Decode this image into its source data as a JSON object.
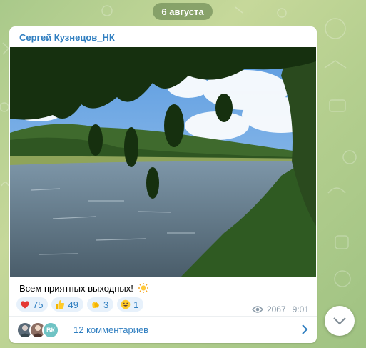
{
  "date_separator": "6 августа",
  "post": {
    "author": "Сергей Кузнецов_НК",
    "caption": "Всем приятных выходных!",
    "caption_emoji": "sun-emoji",
    "reactions": [
      {
        "emoji": "red-heart",
        "count": "75"
      },
      {
        "emoji": "thumbs-up",
        "count": "49"
      },
      {
        "emoji": "clapping-hands",
        "count": "3"
      },
      {
        "emoji": "grinning-face",
        "count": "1"
      }
    ],
    "views": "2067",
    "time": "9:01",
    "comments": {
      "label": "12 комментариев",
      "avatar_initials": "ВК"
    }
  },
  "colors": {
    "accent": "#2f7ec0",
    "reaction_bg": "#e7f1fb",
    "meta": "#8a9aa8"
  }
}
